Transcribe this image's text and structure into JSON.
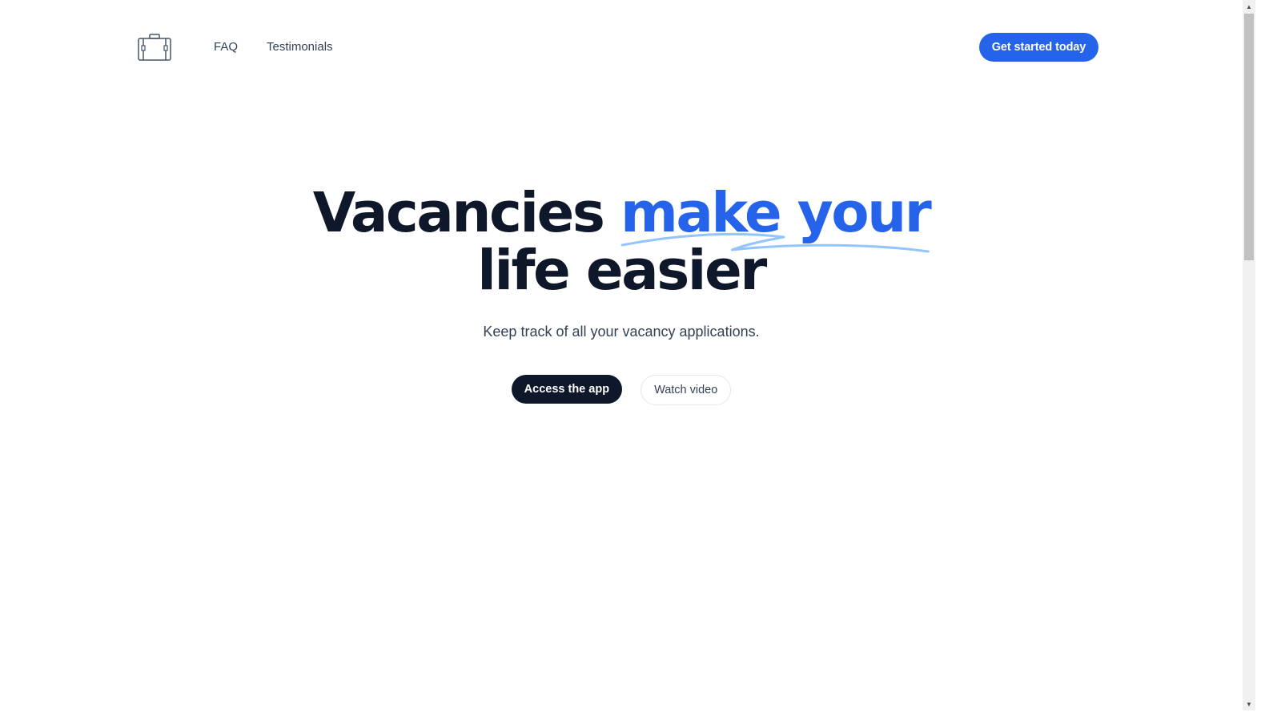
{
  "header": {
    "logo_icon": "briefcase-icon",
    "nav": [
      {
        "label": "FAQ"
      },
      {
        "label": "Testimonials"
      }
    ],
    "cta_label": "Get started today"
  },
  "hero": {
    "title_before": "Vacancies",
    "title_highlight": "make your",
    "title_after": "life easier",
    "subtitle": "Keep track of all your vacancy applications.",
    "primary_button": "Access the app",
    "secondary_button": "Watch video"
  },
  "colors": {
    "accent": "#2563eb",
    "accent_light": "#93c5fd",
    "dark": "#0f172a",
    "text_muted": "#334155"
  },
  "scrollbar": {
    "up_icon": "scroll-up-arrow-icon",
    "down_icon": "scroll-down-arrow-icon"
  }
}
